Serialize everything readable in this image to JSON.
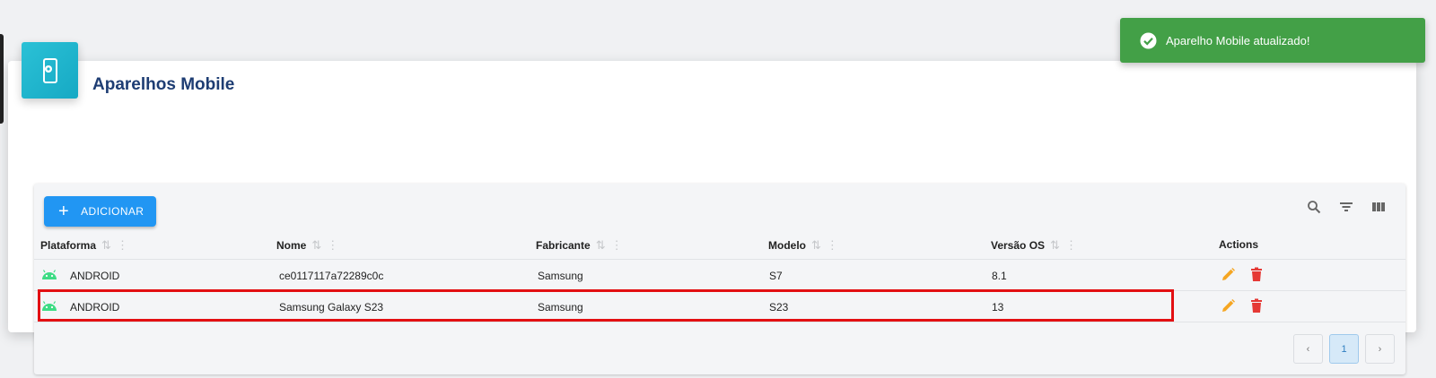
{
  "page": {
    "title": "Aparelhos Mobile"
  },
  "toolbar": {
    "add_label": "ADICIONAR",
    "icons": [
      "search-icon",
      "filter-icon",
      "columns-icon"
    ]
  },
  "table": {
    "columns": [
      "Plataforma",
      "Nome",
      "Fabricante",
      "Modelo",
      "Versão OS",
      "Actions"
    ],
    "rows": [
      {
        "platform": "ANDROID",
        "name": "ce0117117a72289c0c",
        "manufacturer": "Samsung",
        "model": "S7",
        "os_version": "8.1"
      },
      {
        "platform": "ANDROID",
        "name": "Samsung Galaxy S23",
        "manufacturer": "Samsung",
        "model": "S23",
        "os_version": "13"
      }
    ]
  },
  "pagination": {
    "prev": "‹",
    "current": "1",
    "next": "›"
  },
  "toast": {
    "message": "Aparelho Mobile atualizado!"
  },
  "colors": {
    "accent": "#2196f3",
    "success": "#43a047",
    "edit": "#f5a623",
    "delete": "#e53935",
    "android": "#3ddc84",
    "highlight": "#e30f12"
  }
}
